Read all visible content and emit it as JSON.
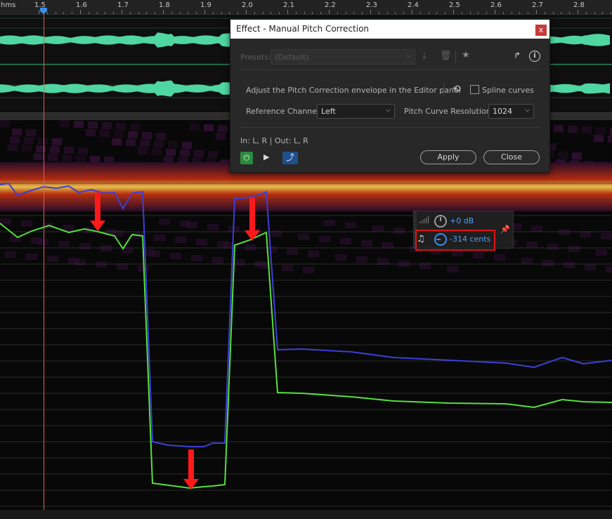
{
  "ruler": {
    "unit": "hms",
    "ticks": [
      "1.5",
      "1.6",
      "1.7",
      "1.8",
      "1.9",
      "2.0",
      "2.1",
      "2.2",
      "2.3",
      "2.4",
      "2.5",
      "2.6",
      "2.7",
      "2.8"
    ]
  },
  "dialog": {
    "title": "Effect - Manual Pitch Correction",
    "close_glyph": "x",
    "presets_label": "Presets:",
    "presets_value": "(Default)",
    "instruction": "Adjust the Pitch Correction envelope in the Editor panel",
    "spline_label": "Spline curves",
    "spline_checked": false,
    "reference_channel_label": "Reference Channel:",
    "reference_channel_value": "Left",
    "resolution_label": "Pitch Curve Resolution:",
    "resolution_value": "1024",
    "io_text": "In: L, R | Out: L, R",
    "apply_label": "Apply",
    "close_label": "Close"
  },
  "hud": {
    "gain_value": "+0 dB",
    "pitch_value": "-314 cents"
  },
  "icons": {
    "download": "download-icon",
    "delete": "trash-icon",
    "favorite": "star-icon",
    "routing": "routing-icon",
    "info": "info-icon",
    "reset": "reset-icon",
    "power": "power-icon",
    "play": "play-icon",
    "loop": "loop-icon",
    "note": "music-note-icon",
    "pin": "pin-icon"
  },
  "colors": {
    "waveform": "#4fd6a2",
    "original_pitch_curve": "#3d3fd6",
    "corrected_pitch_curve": "#54e03c",
    "annotation_arrow": "#ff1a1a",
    "accent": "#3a8ef0"
  }
}
